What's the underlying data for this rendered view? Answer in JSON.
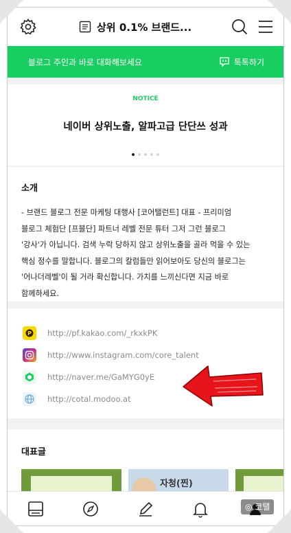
{
  "header": {
    "title": "상위 0.1% 브랜드...",
    "icons": [
      "gear-icon",
      "list-icon",
      "search-icon",
      "menu-icon"
    ]
  },
  "chat_bar": {
    "text": "블로그 주인과 바로 대화해보세요",
    "action_label": "톡톡하기",
    "color": "#19ce60"
  },
  "notice": {
    "label": "NOTICE",
    "title": "네이버 상위노출, 알파고급 단단쓰 성과",
    "pages": 5,
    "current_page": 1
  },
  "intro": {
    "heading": "소개",
    "lines": [
      "- 브랜드 블로그 전문 마케팅 대행사 [코어탤런트] 대표  - 프리미엄",
      "블로그 체험단 [프블단] 파트너 레벨 전문 튜터  그저 그런 블로그",
      "'강사'가 아닙니다. 검색 누락 당하지 않고 상위노출을 골라 먹을 수 있는",
      "핵심 정수를 말합니다.  블로그의 칼럼들만 읽어보아도 당신의 블로그는",
      "'어나더레벨'이 될 거라 확신합니다. 가치를 느끼신다면 지금 바로",
      "함께하세요."
    ]
  },
  "links": [
    {
      "icon": "kakao-icon",
      "url": "http://pf.kakao.com/_rkxkPK",
      "color": "#f7d900"
    },
    {
      "icon": "instagram-icon",
      "url": "http://www.instagram.com/core_talent",
      "color": "#c13584"
    },
    {
      "icon": "naver-icon",
      "url": "http://naver.me/GaMYG0yE",
      "color": "#19ce60"
    },
    {
      "icon": "globe-icon",
      "url": "http://cotal.modoo.at",
      "color": "#6aa9d8"
    }
  ],
  "featured": {
    "heading": "대표글",
    "thumb2_caption": "자청(찐)"
  },
  "bottom_nav": [
    "post-icon",
    "compass-icon",
    "pencil-icon",
    "bell-icon",
    "profile-icon"
  ],
  "watermark": "◎ 코탤"
}
